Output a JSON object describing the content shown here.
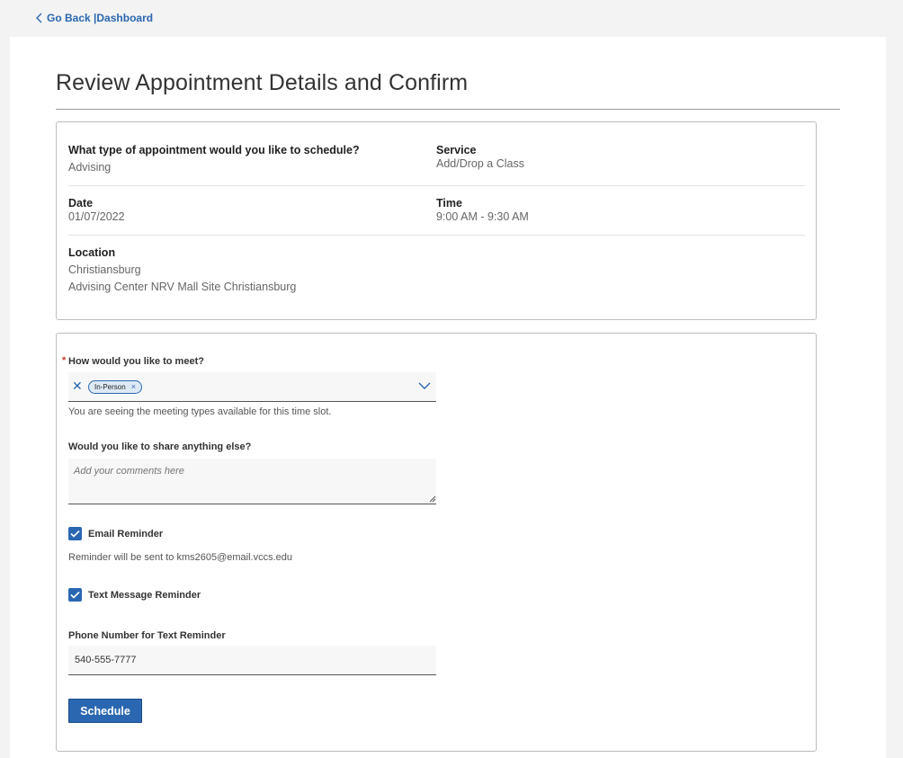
{
  "nav": {
    "back_label": "Go Back |",
    "dashboard_label": "Dashboard"
  },
  "page": {
    "title": "Review Appointment Details and Confirm"
  },
  "details": {
    "appointment_type_label": "What type of appointment would you like to schedule?",
    "appointment_type_value": "Advising",
    "service_label": "Service",
    "service_value": "Add/Drop a Class",
    "date_label": "Date",
    "date_value": "01/07/2022",
    "time_label": "Time",
    "time_value": "9:00 AM - 9:30 AM",
    "location_label": "Location",
    "location_line1": "Christiansburg",
    "location_line2": "Advising Center NRV Mall Site Christiansburg"
  },
  "form": {
    "meet_label": "How would you like to meet?",
    "required_mark": "*",
    "meet_selected": "In-Person",
    "meet_help": "You are seeing the meeting types available for this time slot.",
    "share_label": "Would you like to share anything else?",
    "share_placeholder": "Add your comments here",
    "email_reminder_label": "Email Reminder",
    "email_reminder_checked": true,
    "email_reminder_help": "Reminder will be sent to kms2605@email.vccs.edu",
    "text_reminder_label": "Text Message Reminder",
    "text_reminder_checked": true,
    "phone_label": "Phone Number for Text Reminder",
    "phone_value": "540-555-7777",
    "schedule_button": "Schedule"
  },
  "colors": {
    "accent": "#2a67b0",
    "required": "#c0392b",
    "background": "#f3f3f3"
  }
}
